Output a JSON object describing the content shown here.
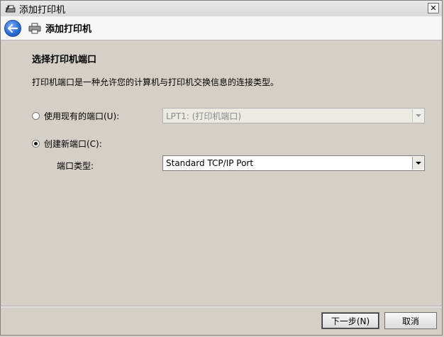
{
  "window": {
    "title": "添加打印机",
    "close_label": "✕"
  },
  "header": {
    "title": "添加打印机"
  },
  "section": {
    "title": "选择打印机端口",
    "description": "打印机端口是一种允许您的计算机与打印机交换信息的连接类型。"
  },
  "options": {
    "existing_port_label": "使用现有的端口(U):",
    "existing_port_value": "LPT1: (打印机端口)",
    "new_port_label": "创建新端口(C):",
    "port_type_label": "端口类型:",
    "port_type_value": "Standard TCP/IP Port"
  },
  "footer": {
    "next_label": "下一步(N)",
    "cancel_label": "取消"
  },
  "colors": {
    "background": "#d4d0c8",
    "accent": "#2b6fd6"
  }
}
